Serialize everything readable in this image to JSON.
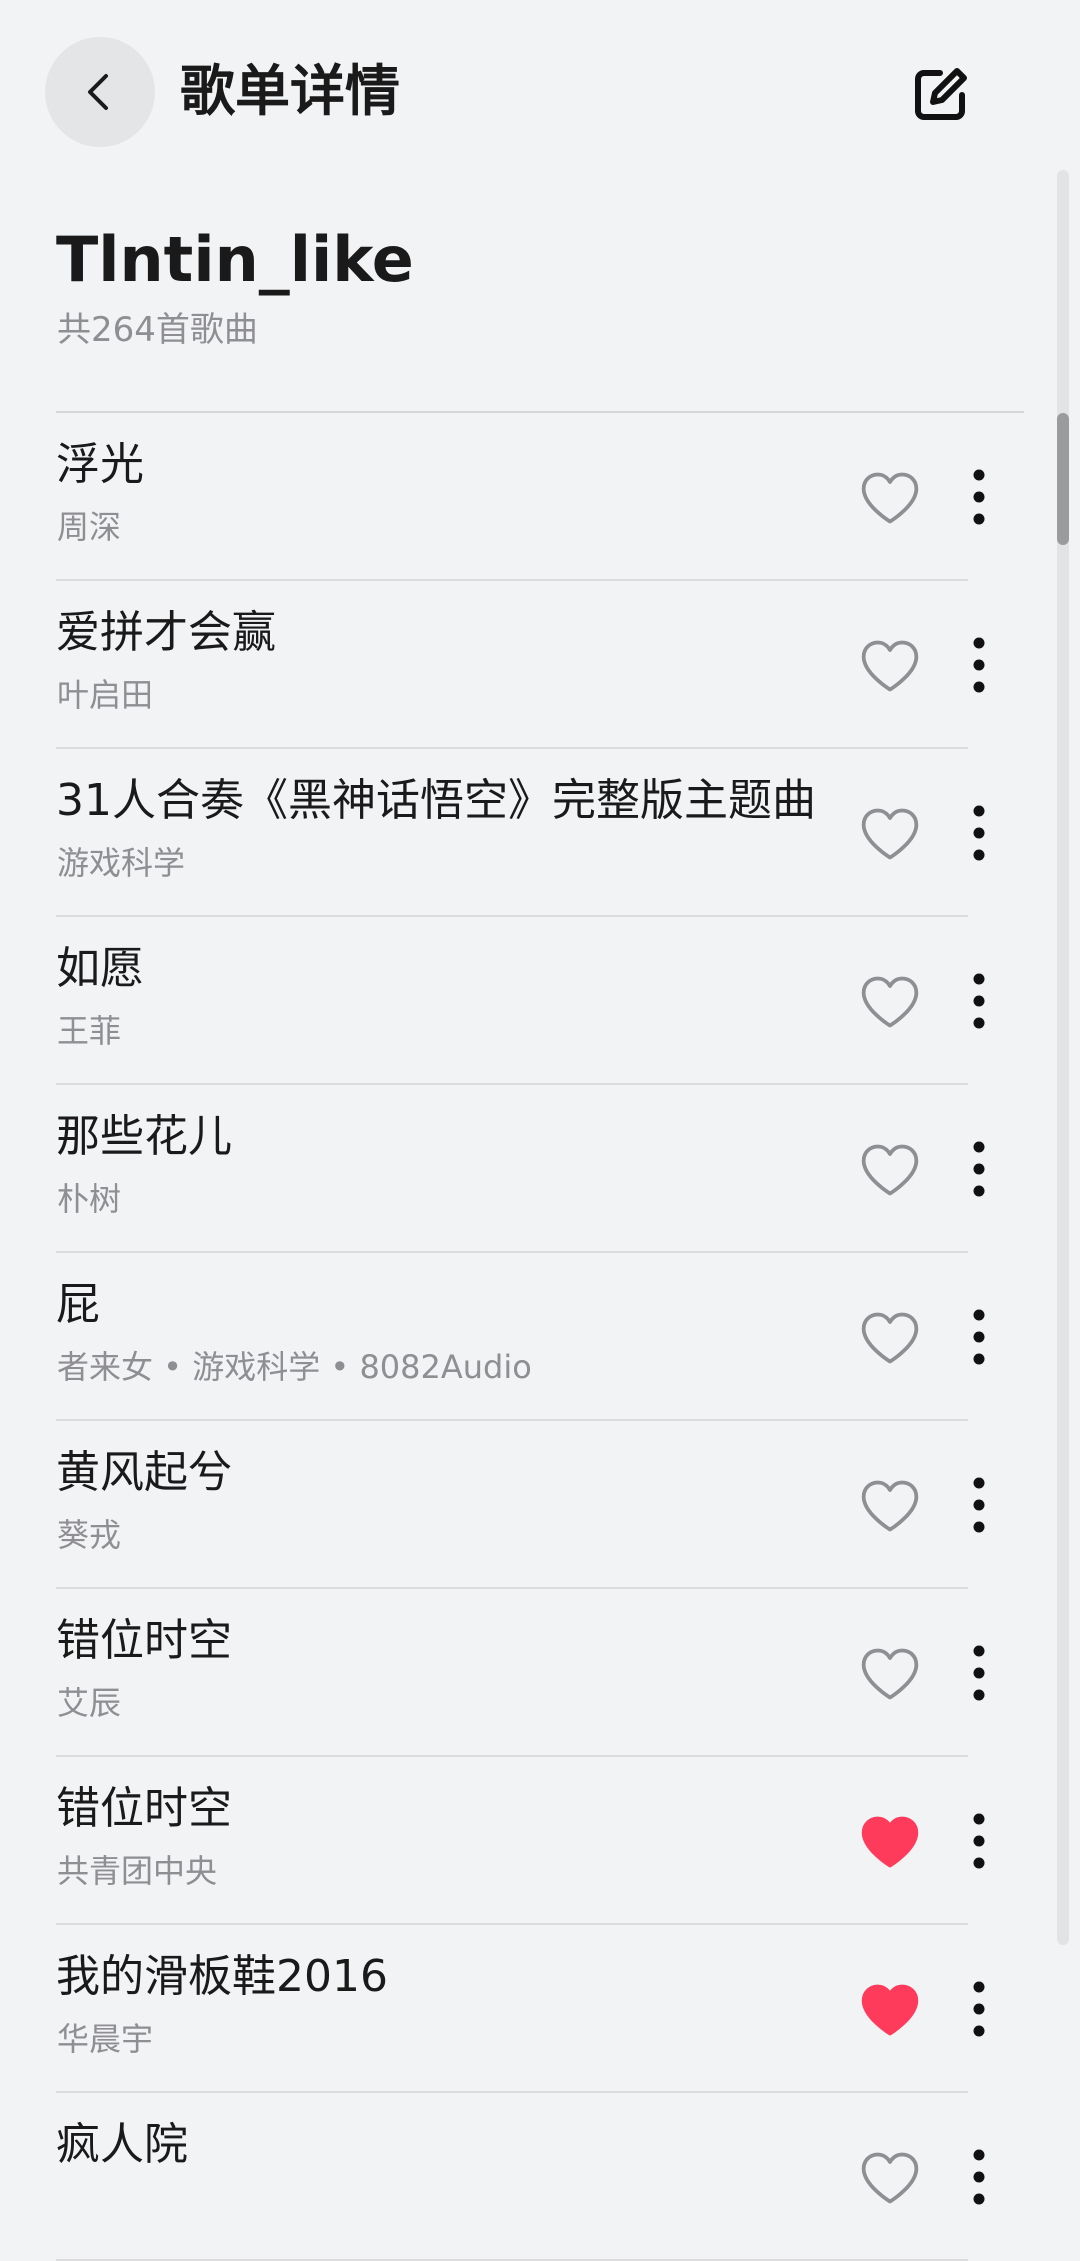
{
  "header": {
    "title": "歌单详情",
    "back_icon": "chevron-left-icon",
    "edit_icon": "edit-icon"
  },
  "playlist": {
    "name": "Tlntin_like",
    "count": "共264首歌曲"
  },
  "colors": {
    "liked": "#ff3b5c",
    "unliked_outline": "#8e8e93",
    "background": "#f2f3f5"
  },
  "songs": [
    {
      "title": "浮光",
      "artist": "周深",
      "liked": false
    },
    {
      "title": "爱拼才会赢",
      "artist": "叶启田",
      "liked": false
    },
    {
      "title": "31人合奏《黑神话悟空》完整版主题曲",
      "artist": "游戏科学",
      "liked": false
    },
    {
      "title": "如愿",
      "artist": "王菲",
      "liked": false
    },
    {
      "title": "那些花儿",
      "artist": "朴树",
      "liked": false
    },
    {
      "title": "屁",
      "artist": "者来女 • 游戏科学 • 8082Audio",
      "liked": false
    },
    {
      "title": "黄风起兮",
      "artist": "葵戎",
      "liked": false
    },
    {
      "title": "错位时空",
      "artist": "艾辰",
      "liked": false
    },
    {
      "title": "错位时空",
      "artist": "共青团中央",
      "liked": true
    },
    {
      "title": "我的滑板鞋2016",
      "artist": "华晨宇",
      "liked": true
    },
    {
      "title": "疯人院",
      "artist": "",
      "liked": false
    }
  ]
}
